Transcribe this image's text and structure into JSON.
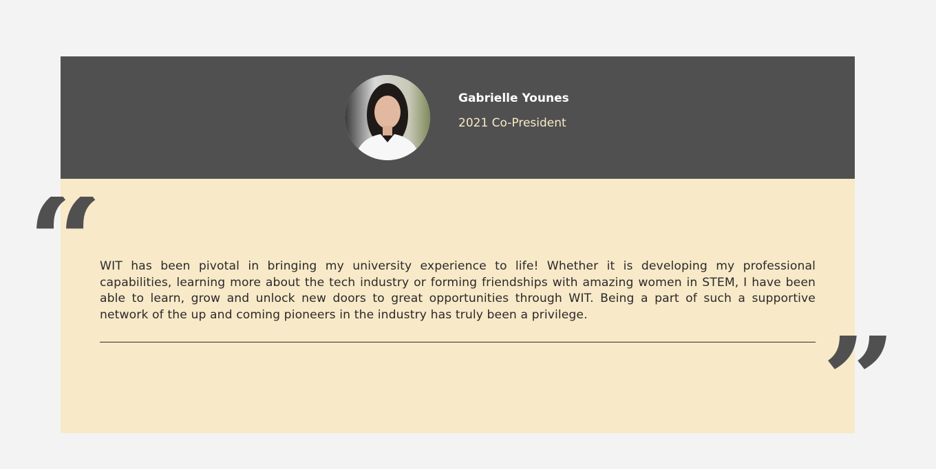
{
  "testimonial": {
    "name": "Gabrielle Younes",
    "role": "2021 Co-President",
    "quote": "WIT has been pivotal in bringing my university experience to life! Whether it is developing my professional capabilities, learning more about the tech industry or forming friendships with amazing women in STEM, I have been able to learn, grow and unlock new doors to great opportunities through WIT. Being a part of such a supportive network of the up and coming pioneers in the industry has truly been a privilege.",
    "open_quote_glyph": "“",
    "close_quote_glyph": "”"
  },
  "colors": {
    "page_background": "#f3f3f3",
    "header_background": "#505050",
    "card_background": "#f8e9c8",
    "name_color": "#ffffff",
    "role_color": "#f8e9c8",
    "quote_mark_color": "#505050"
  },
  "icons": {
    "open_quote": "open-quote-icon",
    "close_quote": "close-quote-icon"
  }
}
